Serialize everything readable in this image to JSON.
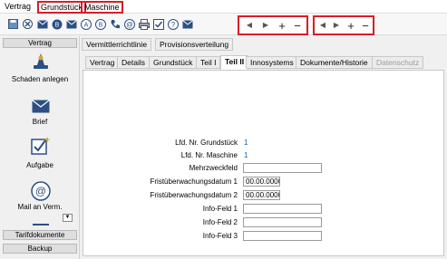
{
  "menu": {
    "vertrag": "Vertrag",
    "grundstueck": "Grundstück",
    "maschine": "Maschine"
  },
  "toolbar": {
    "icons": [
      "save-icon",
      "cancel-icon",
      "mail-icon",
      "contact-icon",
      "email-icon",
      "a-icon",
      "b-icon",
      "phone-icon",
      "at-icon",
      "print-icon",
      "checklist-icon",
      "help-icon",
      "mail-alt-icon"
    ],
    "nav1": {
      "prev": "◀",
      "next": "▶",
      "add": "+",
      "remove": "−"
    },
    "nav2": {
      "prev": "◀",
      "next": "▶",
      "add": "+",
      "remove": "−"
    }
  },
  "sidebar": {
    "header": "Vertrag",
    "items": [
      {
        "label": "Schaden anlegen",
        "icon": "damage-icon"
      },
      {
        "label": "Brief",
        "icon": "letter-icon"
      },
      {
        "label": "Aufgabe",
        "icon": "task-icon"
      },
      {
        "label": "Mail an Verm.",
        "icon": "mail-at-icon"
      }
    ],
    "footer": [
      "Tarifdokumente",
      "Backup"
    ]
  },
  "tabs_top": [
    "Vermittlerrichtlinie",
    "Provisionsverteilung"
  ],
  "tabs": [
    "Vertrag",
    "Details",
    "Grundstück",
    "Teil I",
    "Teil II",
    "Innosystems",
    "Dokumente/Historie",
    "Datenschutz"
  ],
  "active_tab": "Teil II",
  "form": {
    "lfd_grundstueck": {
      "label": "Lfd. Nr. Grundstück",
      "value": "1"
    },
    "lfd_maschine": {
      "label": "Lfd. Nr. Maschine",
      "value": "1"
    },
    "mehrzweckfeld": {
      "label": "Mehrzweckfeld",
      "value": ""
    },
    "frist1": {
      "label": "Fristüberwachungsdatum 1",
      "value": "00.00.0000"
    },
    "frist2": {
      "label": "Fristüberwachungsdatum 2",
      "value": "00.00.0000"
    },
    "info1": {
      "label": "Info-Feld 1",
      "value": ""
    },
    "info2": {
      "label": "Info-Feld 2",
      "value": ""
    },
    "info3": {
      "label": "Info-Feld 3",
      "value": ""
    }
  },
  "colors": {
    "highlight": "#d81e28",
    "value_blue": "#1a5aa0"
  }
}
